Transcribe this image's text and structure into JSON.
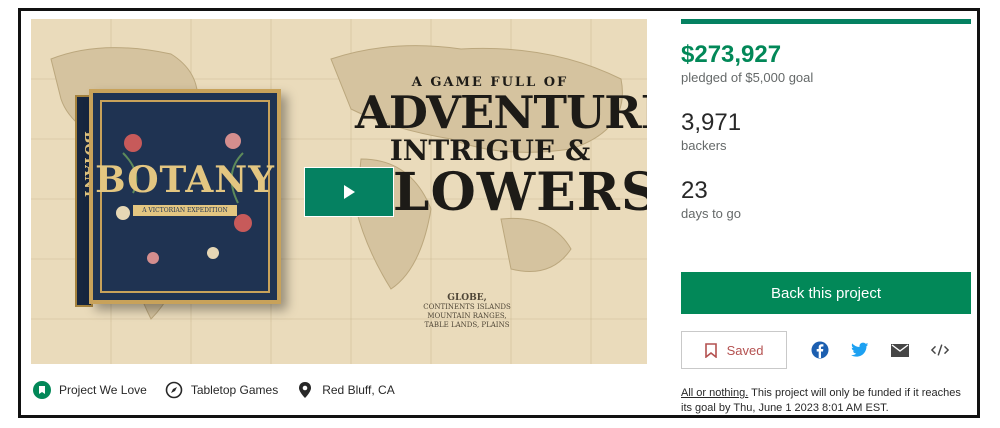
{
  "media": {
    "box_title": "BOTANY",
    "box_subtitle": "A VICTORIAN EXPEDITION",
    "spine_text": "BOTANY",
    "headline_line1": "A GAME FULL OF",
    "headline_line2": "ADVENTURE",
    "headline_line3": "INTRIGUE &",
    "headline_line4": "FLOWERS",
    "globe_title": "GLOBE,",
    "globe_lines": [
      "CONTINENTS ISLANDS",
      "MOUNTAIN RANGES,",
      "TABLE LANDS, PLAINS"
    ],
    "play_icon": "play-icon"
  },
  "tags": [
    {
      "label": "Project We Love",
      "icon": "kickstarter-badge-icon"
    },
    {
      "label": "Tabletop Games",
      "icon": "compass-icon"
    },
    {
      "label": "Red Bluff, CA",
      "icon": "location-pin-icon"
    }
  ],
  "stats": {
    "pledged_amount": "$273,927",
    "pledged_label": "pledged of $5,000 goal",
    "backers_count": "3,971",
    "backers_label": "backers",
    "days_count": "23",
    "days_label": "days to go"
  },
  "actions": {
    "back_label": "Back this project",
    "saved_label": "Saved",
    "share_icons": [
      "facebook-icon",
      "twitter-icon",
      "email-icon",
      "embed-code-icon"
    ]
  },
  "note": {
    "link_text": "All or nothing.",
    "text": " This project will only be funded if it reaches its goal by Thu, June 1 2023 8:01 AM EST."
  },
  "colors": {
    "accent_green": "#028858",
    "saved_red": "#b45150",
    "facebook": "#1c5fb0",
    "twitter": "#1da1f2"
  }
}
